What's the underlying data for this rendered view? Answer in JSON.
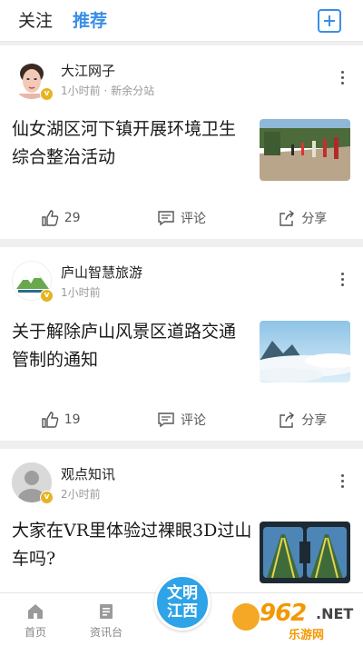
{
  "header": {
    "tabs": [
      {
        "label": "关注",
        "active": false
      },
      {
        "label": "推荐",
        "active": true
      }
    ],
    "accent": "#3a8ee6",
    "add_icon": "add-square-icon"
  },
  "feed": [
    {
      "author": "大江网子",
      "meta": "1小时前 · 新余分站",
      "title": "仙女湖区河下镇开展环境卫生综合整治活动",
      "likes": "29",
      "comment_label": "评论",
      "share_label": "分享"
    },
    {
      "author": "庐山智慧旅游",
      "meta": "1小时前",
      "title": "关于解除庐山风景区道路交通管制的通知",
      "likes": "19",
      "comment_label": "评论",
      "share_label": "分享"
    },
    {
      "author": "观点知讯",
      "meta": "2小时前",
      "title": "大家在VR里体验过裸眼3D过山车吗?"
    }
  ],
  "bottom_nav": {
    "items": [
      {
        "label": "首页",
        "icon": "home-icon"
      },
      {
        "label": "资讯台",
        "icon": "news-icon"
      }
    ],
    "center_button": {
      "line1": "文明",
      "line2": "江西",
      "color": "#2fa3e8"
    }
  },
  "watermark": {
    "number": "962",
    "suffix": ".NET",
    "site": "乐游网"
  }
}
